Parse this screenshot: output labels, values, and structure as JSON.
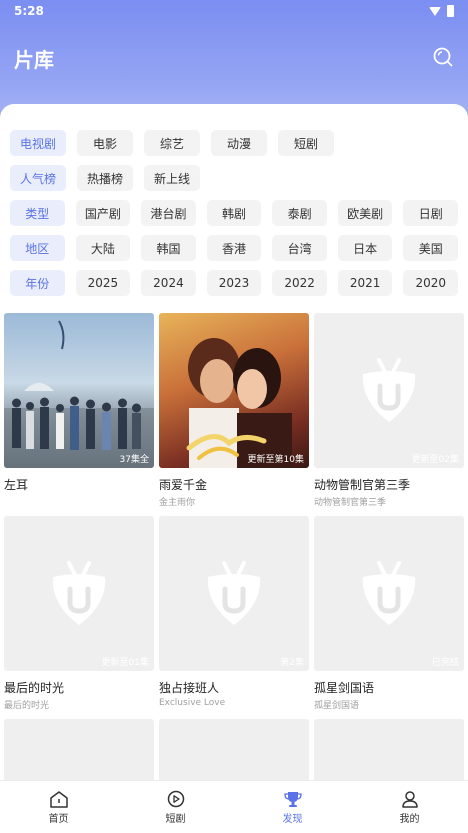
{
  "status_bar": {
    "time": "5:28"
  },
  "header": {
    "title": "片库"
  },
  "filters": {
    "row1": [
      "电视剧",
      "电影",
      "综艺",
      "动漫",
      "短剧"
    ],
    "row2": [
      "人气榜",
      "热播榜",
      "新上线"
    ],
    "row3": [
      "类型",
      "国产剧",
      "港台剧",
      "韩剧",
      "泰剧",
      "欧美剧",
      "日剧"
    ],
    "row4": [
      "地区",
      "大陆",
      "韩国",
      "香港",
      "台湾",
      "日本",
      "美国"
    ],
    "row5": [
      "年份",
      "2025",
      "2024",
      "2023",
      "2022",
      "2021",
      "2020"
    ]
  },
  "cards": [
    {
      "title": "左耳",
      "subtitle": "",
      "badge": "37集全"
    },
    {
      "title": "雨爱千金",
      "subtitle": "金主雨你",
      "badge": "更新至第10集"
    },
    {
      "title": "动物管制官第三季",
      "subtitle": "动物管制官第三季",
      "badge": "更新至02集"
    },
    {
      "title": "最后的时光",
      "subtitle": "最后的时光",
      "badge": "更新至01集"
    },
    {
      "title": "独占接班人",
      "subtitle": "Exclusive Love",
      "badge": "第2集"
    },
    {
      "title": "孤星剑国语",
      "subtitle": "孤星剑国语",
      "badge": "已完结"
    }
  ],
  "tabbar": {
    "home": "首页",
    "short": "短剧",
    "discover": "发现",
    "mine": "我的"
  },
  "colors": {
    "accent": "#5a72e6",
    "header_top": "#7b8ef2",
    "chip_bg": "#f3f3f4"
  }
}
